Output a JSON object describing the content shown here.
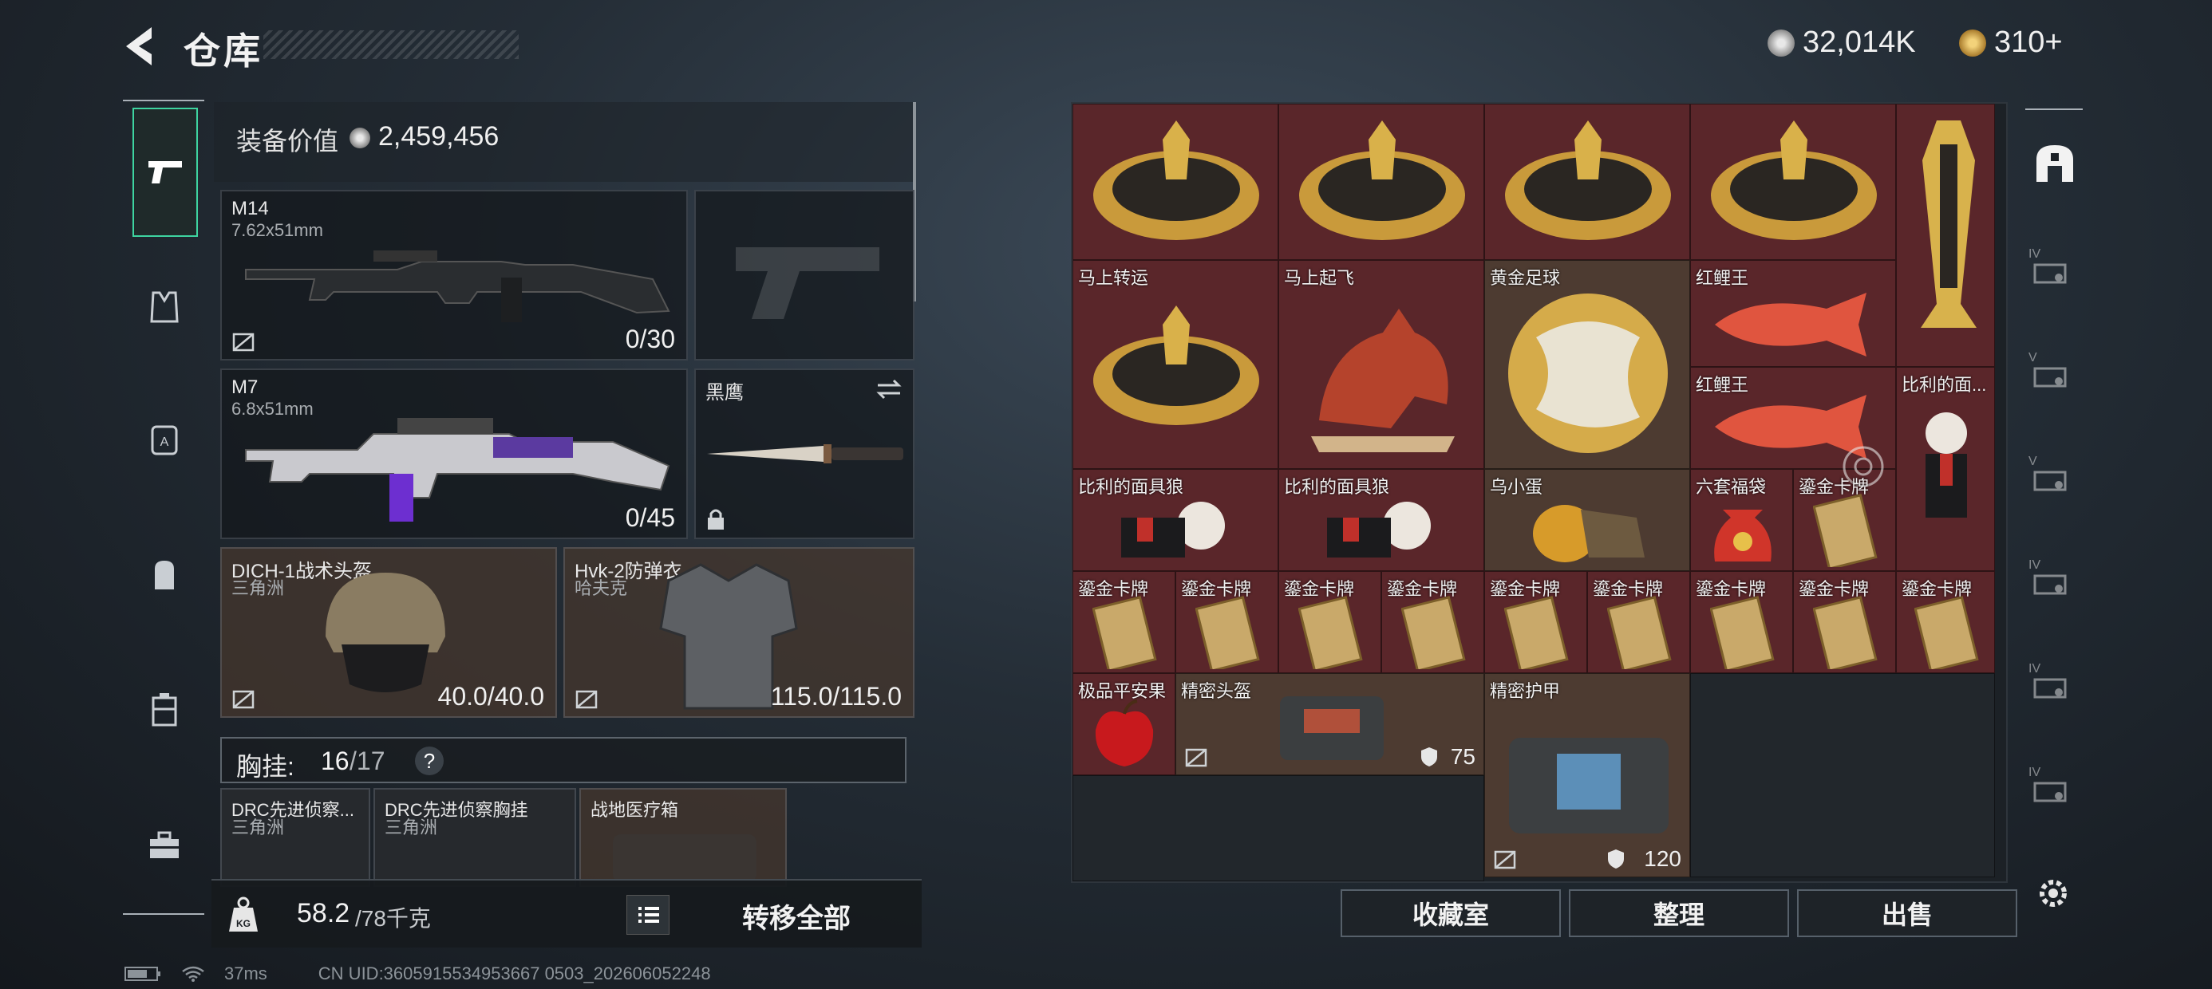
{
  "header": {
    "title": "仓库",
    "currency_silver": "32,014K",
    "currency_gold": "310+",
    "colors": {
      "accent": "#3ed4a0",
      "stash_item_bg": "#5a262a",
      "gold": "#d4a84a"
    }
  },
  "tabs": [
    {
      "icon": "pistol-icon",
      "active": true
    },
    {
      "icon": "vest-icon",
      "active": false
    },
    {
      "icon": "backpack-a-icon",
      "active": false
    },
    {
      "icon": "backpack-icon",
      "active": false
    },
    {
      "icon": "case-icon",
      "active": false
    },
    {
      "icon": "toolbox-icon",
      "active": false
    }
  ],
  "loadout": {
    "equip_value_label": "装备价值",
    "equip_value": "2,459,456",
    "primary": {
      "name": "M14",
      "caliber": "7.62x51mm",
      "ammo": "0/30"
    },
    "secondary": {
      "name": "M7",
      "caliber": "6.8x51mm",
      "ammo": "0/45"
    },
    "melee": {
      "name": "黑鹰"
    },
    "helmet": {
      "name": "DICH-1战术头盔",
      "sub": "三角洲",
      "durability": "40.0/40.0"
    },
    "armor": {
      "name": "Hvk-2防弹衣",
      "sub": "哈夫克",
      "durability": "115.0/115.0"
    },
    "chest_rig": {
      "label": "胸挂:",
      "used": "16",
      "total": "/17",
      "help": "?"
    },
    "rig_items": [
      {
        "name": "DRC先进侦察...",
        "sub": "三角洲"
      },
      {
        "name": "DRC先进侦察胸挂",
        "sub": "三角洲"
      },
      {
        "name": "战地医疗箱",
        "sub": ""
      }
    ],
    "weight_icon": "KG",
    "weight": "58.2",
    "weight_max": "/78千克",
    "transfer_all": "转移全部"
  },
  "stash": {
    "items": [
      {
        "label": "",
        "icon": "fortune-wheel"
      },
      {
        "label": "",
        "icon": "fortune-wheel"
      },
      {
        "label": "",
        "icon": "fortune-wheel"
      },
      {
        "label": "",
        "icon": "fortune-wheel"
      },
      {
        "label": "",
        "icon": "golden-trophy"
      },
      {
        "label": "马上转运",
        "icon": "fortune-wheel"
      },
      {
        "label": "马上起飞",
        "icon": "red-horse"
      },
      {
        "label": "黄金足球",
        "icon": "golden-ball"
      },
      {
        "label": "红鲤王",
        "icon": "red-carp"
      },
      {
        "label": "红鲤王",
        "icon": "red-carp"
      },
      {
        "label": "比利的面...",
        "icon": "puppet-doll"
      },
      {
        "label": "比利的面具狼",
        "icon": "puppet-wolf"
      },
      {
        "label": "比利的面具狼",
        "icon": "puppet-wolf"
      },
      {
        "label": "乌小蛋",
        "icon": "egg-figure"
      },
      {
        "label": "六套福袋",
        "icon": "lucky-bag"
      },
      {
        "label": "鎏金卡牌",
        "icon": "gold-card"
      },
      {
        "label": "鎏金卡牌",
        "icon": "gold-card"
      },
      {
        "label": "鎏金卡牌",
        "icon": "gold-card"
      },
      {
        "label": "鎏金卡牌",
        "icon": "gold-card"
      },
      {
        "label": "鎏金卡牌",
        "icon": "gold-card"
      },
      {
        "label": "鎏金卡牌",
        "icon": "gold-card"
      },
      {
        "label": "鎏金卡牌",
        "icon": "gold-card"
      },
      {
        "label": "鎏金卡牌",
        "icon": "gold-card"
      },
      {
        "label": "鎏金卡牌",
        "icon": "gold-card"
      },
      {
        "label": "鎏金卡牌",
        "icon": "gold-card"
      },
      {
        "label": "极品平安果",
        "icon": "red-apple"
      },
      {
        "label": "精密头盔",
        "icon": "helmet-case",
        "value": "75"
      },
      {
        "label": "精密护甲",
        "icon": "armor-case",
        "value": "120"
      }
    ]
  },
  "rail": [
    "IV",
    "V",
    "V",
    "IV",
    "IV",
    "IV"
  ],
  "bottom": {
    "collection": "收藏室",
    "sort": "整理",
    "sell": "出售"
  },
  "status": {
    "ping": "37ms",
    "uid": "CN UID:3605915534953667 0503_202606052248"
  }
}
